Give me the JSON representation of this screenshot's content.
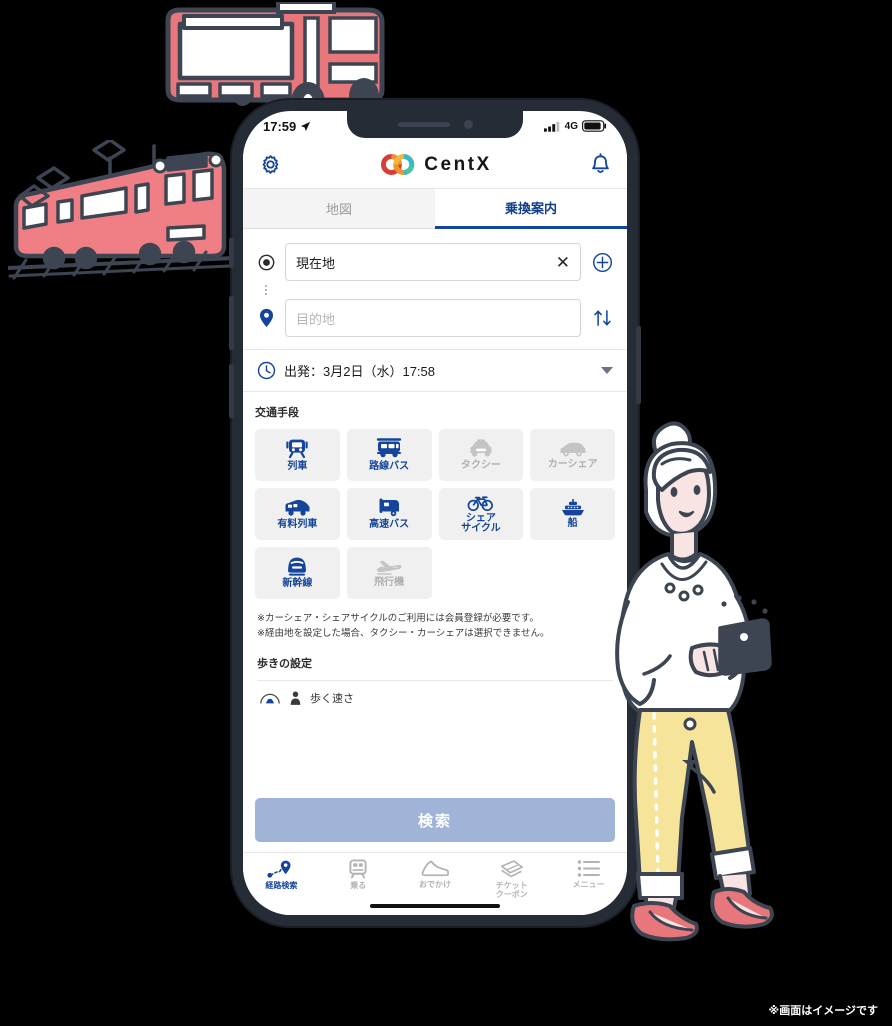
{
  "statusbar": {
    "time": "17:59",
    "location_icon": "location-arrow-icon",
    "signal_icon": "signal-bars-icon",
    "network": "4G",
    "battery_icon": "battery-icon"
  },
  "header": {
    "settings_icon": "gear-icon",
    "logo_icon": "centx-rings-logo",
    "logo_text": "CentX",
    "notification_icon": "bell-icon"
  },
  "tabs": [
    {
      "label": "地図",
      "active": false,
      "name": "tab-map"
    },
    {
      "label": "乗換案内",
      "active": true,
      "name": "tab-transfer-guide"
    }
  ],
  "route": {
    "origin": {
      "icon": "current-location-icon",
      "value": "現在地",
      "clear_icon": "close-icon",
      "add_icon": "plus-circle-icon"
    },
    "destination": {
      "icon": "map-pin-icon",
      "placeholder": "目的地",
      "swap_icon": "swap-vertical-icon"
    }
  },
  "departure": {
    "clock_icon": "clock-icon",
    "text": "出発：3月2日（水）17:58",
    "caret_icon": "chevron-down-icon"
  },
  "modes": {
    "title": "交通手段",
    "items": [
      {
        "label": "列車",
        "icon": "train-icon",
        "enabled": true
      },
      {
        "label": "路線バス",
        "icon": "route-bus-icon",
        "enabled": true
      },
      {
        "label": "タクシー",
        "icon": "taxi-icon",
        "enabled": false
      },
      {
        "label": "カーシェア",
        "icon": "car-share-icon",
        "enabled": false
      },
      {
        "label": "有料列車",
        "icon": "limited-express-icon",
        "enabled": true
      },
      {
        "label": "高速バス",
        "icon": "highway-bus-icon",
        "enabled": true
      },
      {
        "label": "シェア\nサイクル",
        "icon": "share-cycle-icon",
        "enabled": true
      },
      {
        "label": "船",
        "icon": "ferry-icon",
        "enabled": true
      },
      {
        "label": "新幹線",
        "icon": "shinkansen-icon",
        "enabled": true
      },
      {
        "label": "飛行機",
        "icon": "airplane-icon",
        "enabled": false
      }
    ]
  },
  "notes": [
    "※カーシェア・シェアサイクルのご利用には会員登録が必要です。",
    "※経由地を設定した場合、タクシー・カーシェアは選択できません。"
  ],
  "walk": {
    "title": "歩きの設定",
    "speed_label": "歩く速さ",
    "person_icon": "person-icon",
    "gauge_icon": "speed-gauge-icon"
  },
  "search_button": {
    "label": "検索"
  },
  "bottom_nav": [
    {
      "label": "経路検索",
      "icon": "route-search-icon",
      "active": true
    },
    {
      "label": "乗る",
      "icon": "board-transit-icon",
      "active": false
    },
    {
      "label": "おでかけ",
      "icon": "sneaker-icon",
      "active": false
    },
    {
      "label": "チケット\nクーポン",
      "icon": "ticket-coupon-icon",
      "active": false
    },
    {
      "label": "メニュー",
      "icon": "menu-list-icon",
      "active": false
    }
  ],
  "caption": "※画面はイメージです",
  "illustrations": {
    "bus": "hand-drawn-red-bus",
    "train": "hand-drawn-red-train",
    "woman": "hand-drawn-woman-with-phone"
  },
  "colors": {
    "brand_blue": "#14459b",
    "button_blue": "#9fb4d6",
    "disabled_gray": "#b0b0b0",
    "illus_red": "#e8777c",
    "illus_outline": "#3d4552",
    "illus_yellow": "#f6e49a"
  }
}
